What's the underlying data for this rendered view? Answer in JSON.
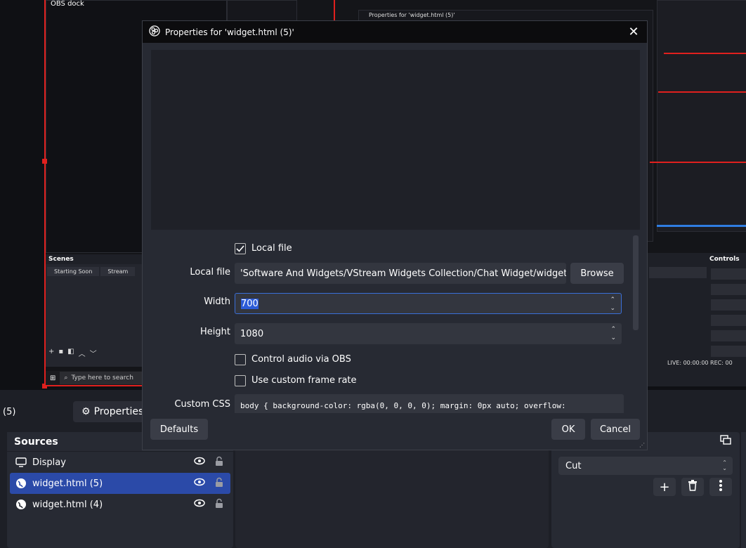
{
  "background": {
    "dock_title": "OBS dock",
    "scenes_header": "Scenes",
    "scene_tabs": [
      "Starting Soon",
      "Stream"
    ],
    "taskbar_search": "Type here to search",
    "controls_header": "Controls",
    "status_text": "LIVE: 00:00:00   REC: 00",
    "nested_dialog_title": "Properties for 'widget.html (5)'"
  },
  "toolbar": {
    "scene_count": "(5)",
    "properties_label": "Properties"
  },
  "sources": {
    "header": "Sources",
    "items": [
      {
        "label": "Display",
        "icon": "monitor-icon",
        "selected": false
      },
      {
        "label": "widget.html (5)",
        "icon": "globe-icon",
        "selected": true
      },
      {
        "label": "widget.html (4)",
        "icon": "globe-icon",
        "selected": false
      }
    ]
  },
  "transitions": {
    "selected": "Cut"
  },
  "dialog": {
    "title": "Properties for 'widget.html (5)'",
    "local_file_checkbox": {
      "label": "Local file",
      "checked": true
    },
    "local_file": {
      "label": "Local file",
      "value": "'Software And Widgets/VStream Widgets Collection/Chat Widget/widget.html"
    },
    "browse_label": "Browse",
    "width": {
      "label": "Width",
      "value": "700"
    },
    "height": {
      "label": "Height",
      "value": "1080"
    },
    "control_audio": {
      "label": "Control audio via OBS",
      "checked": false
    },
    "custom_fps": {
      "label": "Use custom frame rate",
      "checked": false
    },
    "custom_css": {
      "label": "Custom CSS",
      "value": "body { background-color: rgba(0, 0, 0, 0); margin: 0px auto; overflow:"
    },
    "defaults_label": "Defaults",
    "ok_label": "OK",
    "cancel_label": "Cancel"
  },
  "colors": {
    "accent": "#2b4aa8",
    "selection_red": "#e0201e",
    "panel": "#272a33",
    "background": "#1d1f26"
  }
}
